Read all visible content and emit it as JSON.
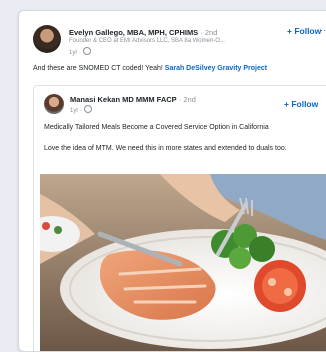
{
  "post": {
    "author_name": "Evelyn Gallego, MBA, MPH, CPHIMS",
    "author_degree": " · 2nd",
    "author_subtitle": "Founder & CEO at EMI Advisors LLC, SBA 8a Women-O...",
    "author_time": "1yr ·",
    "follow_label": "+ Follow",
    "menu": "⋯",
    "text_prefix": "And these are SNOMED CT coded! Yeah! ",
    "text_link": "Sarah DeSilvey Gravity Project"
  },
  "shared_post": {
    "author_name": "Manasi Kekan MD MMM FACP",
    "author_degree": " · 2nd",
    "author_time": "1yr ·",
    "follow_label": "+ Follow",
    "headline": "Medically Tailored Meals Become a Covered Service Option in California",
    "body_before": "Love the idea of MTM. We need this in more states and extended to duals too."
  },
  "colors": {
    "link": "#0a66c2",
    "text": "#1d2226",
    "muted": "#8a9199"
  }
}
